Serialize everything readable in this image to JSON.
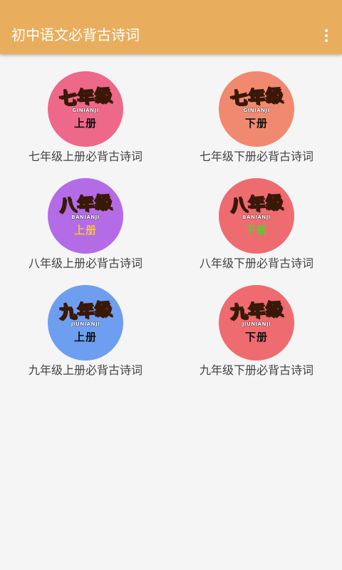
{
  "app": {
    "title": "初中语文必背古诗词",
    "overflow_icon": "more-vert-icon",
    "toolbar_color": "#E9AE5D"
  },
  "books": [
    {
      "label": "七年级上册必背古诗词",
      "logo_text": "七年级",
      "logo_pinyin": "GINIANJI",
      "volume": "上册",
      "circle_color": "#EE6889",
      "logo_color": "#F5C23A",
      "volume_color": "#111111"
    },
    {
      "label": "七年级下册必背古诗词",
      "logo_text": "七年级",
      "logo_pinyin": "GINIANJI",
      "volume": "下册",
      "circle_color": "#F18970",
      "logo_color": "#F5C23A",
      "volume_color": "#111111"
    },
    {
      "label": "八年级上册必背古诗词",
      "logo_text": "八年级",
      "logo_pinyin": "BANIANJI",
      "volume": "上册",
      "circle_color": "#B46BE6",
      "logo_color": "#F5C23A",
      "volume_color": "#F5C23A"
    },
    {
      "label": "八年级下册必背古诗词",
      "logo_text": "八年级",
      "logo_pinyin": "BANIANJI",
      "volume": "下册",
      "circle_color": "#EE6B70",
      "logo_color": "#62C832",
      "volume_color": "#62C832"
    },
    {
      "label": "九年级上册必背古诗词",
      "logo_text": "九年级",
      "logo_pinyin": "JIUNIANJI",
      "volume": "上册",
      "circle_color": "#6E9EEF",
      "logo_color": "#F5C23A",
      "volume_color": "#111111"
    },
    {
      "label": "九年级下册必背古诗词",
      "logo_text": "九年级",
      "logo_pinyin": "JIUNIANJI",
      "volume": "下册",
      "circle_color": "#EE6B70",
      "logo_color": "#3ED9C8",
      "volume_color": "#111111"
    }
  ]
}
